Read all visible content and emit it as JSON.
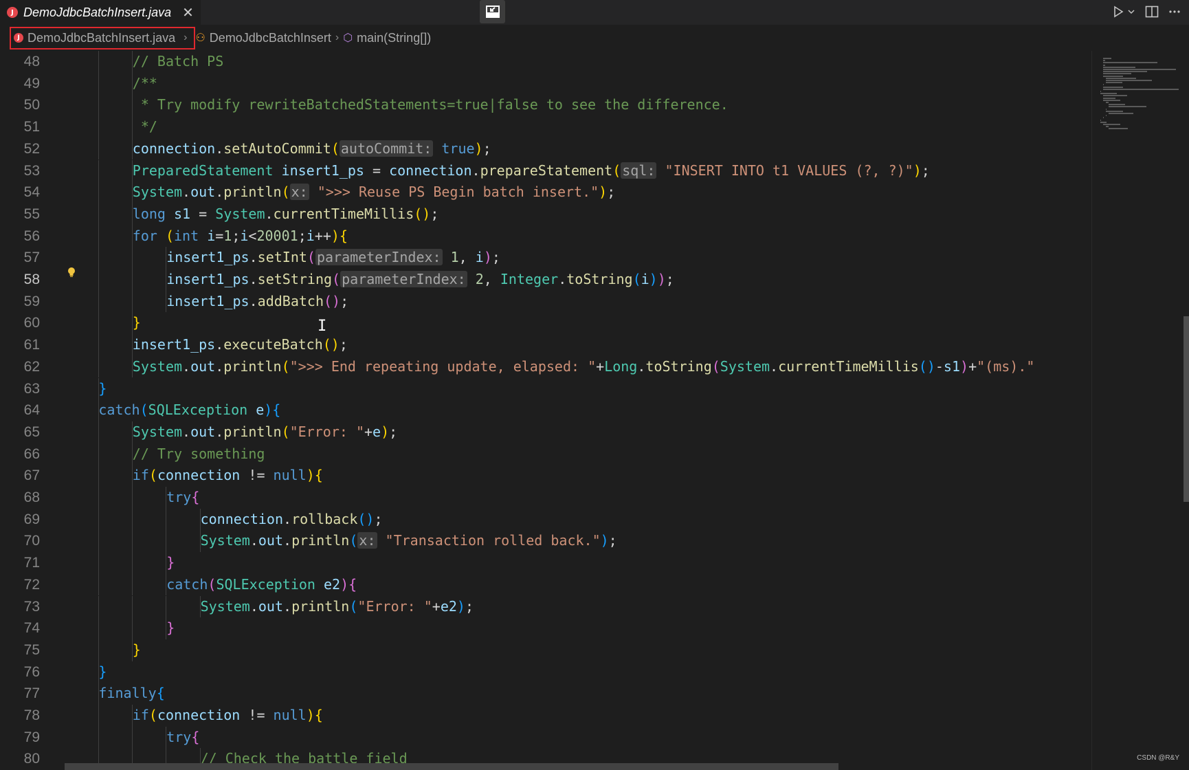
{
  "tab": {
    "title": "DemoJdbcBatchInsert.java",
    "close": "✕"
  },
  "breadcrumb": {
    "file": "DemoJdbcBatchInsert.java",
    "class": "DemoJdbcBatchInsert",
    "method": "main(String[])"
  },
  "editor": {
    "active_line": 58,
    "lines": [
      {
        "n": "48",
        "indent": 2,
        "tokens": [
          [
            "com",
            "// Batch PS"
          ]
        ]
      },
      {
        "n": "49",
        "indent": 2,
        "tokens": [
          [
            "com",
            "/**"
          ]
        ]
      },
      {
        "n": "50",
        "indent": 2,
        "tokens": [
          [
            "com",
            " * Try modify rewriteBatchedStatements=true|false to see the difference."
          ]
        ]
      },
      {
        "n": "51",
        "indent": 2,
        "tokens": [
          [
            "com",
            " */"
          ]
        ]
      },
      {
        "n": "52",
        "indent": 2,
        "tokens": [
          [
            "var",
            "connection"
          ],
          [
            "",
            "."
          ],
          [
            "fn",
            "setAutoCommit"
          ],
          [
            "b1",
            "("
          ],
          [
            "hint",
            "autoCommit:"
          ],
          [
            "",
            " "
          ],
          [
            "kw",
            "true"
          ],
          [
            "b1",
            ")"
          ],
          [
            "",
            ";"
          ]
        ]
      },
      {
        "n": "53",
        "indent": 2,
        "tokens": [
          [
            "type",
            "PreparedStatement"
          ],
          [
            "",
            " "
          ],
          [
            "var",
            "insert1_ps"
          ],
          [
            "",
            " = "
          ],
          [
            "var",
            "connection"
          ],
          [
            "",
            "."
          ],
          [
            "fn",
            "prepareStatement"
          ],
          [
            "b1",
            "("
          ],
          [
            "hint",
            "sql:"
          ],
          [
            "",
            " "
          ],
          [
            "str",
            "\"INSERT INTO t1 VALUES (?, ?)\""
          ],
          [
            "b1",
            ")"
          ],
          [
            "",
            ";"
          ]
        ]
      },
      {
        "n": "54",
        "indent": 2,
        "tokens": [
          [
            "type",
            "System"
          ],
          [
            "",
            "."
          ],
          [
            "var",
            "out"
          ],
          [
            "",
            "."
          ],
          [
            "fn",
            "println"
          ],
          [
            "b1",
            "("
          ],
          [
            "hint",
            "x:"
          ],
          [
            "",
            " "
          ],
          [
            "str",
            "\">>> Reuse PS Begin batch insert.\""
          ],
          [
            "b1",
            ")"
          ],
          [
            "",
            ";"
          ]
        ]
      },
      {
        "n": "55",
        "indent": 2,
        "tokens": [
          [
            "kw",
            "long"
          ],
          [
            "",
            " "
          ],
          [
            "var",
            "s1"
          ],
          [
            "",
            " = "
          ],
          [
            "type",
            "System"
          ],
          [
            "",
            "."
          ],
          [
            "fn",
            "currentTimeMillis"
          ],
          [
            "b1",
            "()"
          ],
          [
            "",
            ";"
          ]
        ]
      },
      {
        "n": "56",
        "indent": 2,
        "tokens": [
          [
            "kw",
            "for"
          ],
          [
            "",
            " "
          ],
          [
            "b1",
            "("
          ],
          [
            "kw",
            "int"
          ],
          [
            "",
            " "
          ],
          [
            "var",
            "i"
          ],
          [
            "",
            "="
          ],
          [
            "num",
            "1"
          ],
          [
            "",
            ";"
          ],
          [
            "var",
            "i"
          ],
          [
            "",
            "<"
          ],
          [
            "num",
            "20001"
          ],
          [
            "",
            ";"
          ],
          [
            "var",
            "i"
          ],
          [
            "",
            "++"
          ],
          [
            "b1",
            ")"
          ],
          [
            "b1",
            "{"
          ]
        ]
      },
      {
        "n": "57",
        "indent": 3,
        "tokens": [
          [
            "var",
            "insert1_ps"
          ],
          [
            "",
            "."
          ],
          [
            "fn",
            "setInt"
          ],
          [
            "b2",
            "("
          ],
          [
            "hint",
            "parameterIndex:"
          ],
          [
            "",
            " "
          ],
          [
            "num",
            "1"
          ],
          [
            "",
            ", "
          ],
          [
            "var",
            "i"
          ],
          [
            "b2",
            ")"
          ],
          [
            "",
            ";"
          ]
        ]
      },
      {
        "n": "58",
        "indent": 3,
        "tokens": [
          [
            "var",
            "insert1_ps"
          ],
          [
            "",
            "."
          ],
          [
            "fn",
            "setString"
          ],
          [
            "b2",
            "("
          ],
          [
            "hint",
            "parameterIndex:"
          ],
          [
            "",
            " "
          ],
          [
            "num",
            "2"
          ],
          [
            "",
            ", "
          ],
          [
            "type",
            "Integer"
          ],
          [
            "",
            "."
          ],
          [
            "fn",
            "toString"
          ],
          [
            "b3",
            "("
          ],
          [
            "var",
            "i"
          ],
          [
            "b3",
            ")"
          ],
          [
            "b2",
            ")"
          ],
          [
            "",
            ";"
          ]
        ]
      },
      {
        "n": "59",
        "indent": 3,
        "tokens": [
          [
            "var",
            "insert1_ps"
          ],
          [
            "",
            "."
          ],
          [
            "fn",
            "addBatch"
          ],
          [
            "b2",
            "()"
          ],
          [
            "",
            ";"
          ]
        ]
      },
      {
        "n": "60",
        "indent": 2,
        "tokens": [
          [
            "b1",
            "}"
          ]
        ]
      },
      {
        "n": "61",
        "indent": 2,
        "tokens": [
          [
            "var",
            "insert1_ps"
          ],
          [
            "",
            "."
          ],
          [
            "fn",
            "executeBatch"
          ],
          [
            "b1",
            "()"
          ],
          [
            "",
            ";"
          ]
        ]
      },
      {
        "n": "62",
        "indent": 2,
        "tokens": [
          [
            "type",
            "System"
          ],
          [
            "",
            "."
          ],
          [
            "var",
            "out"
          ],
          [
            "",
            "."
          ],
          [
            "fn",
            "println"
          ],
          [
            "b1",
            "("
          ],
          [
            "str",
            "\">>> End repeating update, elapsed: \""
          ],
          [
            "",
            "+"
          ],
          [
            "type",
            "Long"
          ],
          [
            "",
            "."
          ],
          [
            "fn",
            "toString"
          ],
          [
            "b2",
            "("
          ],
          [
            "type",
            "System"
          ],
          [
            "",
            "."
          ],
          [
            "fn",
            "currentTimeMillis"
          ],
          [
            "b3",
            "()"
          ],
          [
            "",
            "-"
          ],
          [
            "var",
            "s1"
          ],
          [
            "b2",
            ")"
          ],
          [
            "",
            "+"
          ],
          [
            "str",
            "\"(ms).\""
          ]
        ]
      },
      {
        "n": "63",
        "indent": 1,
        "tokens": [
          [
            "b3",
            "}"
          ]
        ]
      },
      {
        "n": "64",
        "indent": 1,
        "tokens": [
          [
            "kw",
            "catch"
          ],
          [
            "b3",
            "("
          ],
          [
            "type",
            "SQLException"
          ],
          [
            "",
            " "
          ],
          [
            "var",
            "e"
          ],
          [
            "b3",
            ")"
          ],
          [
            "b3",
            "{"
          ]
        ]
      },
      {
        "n": "65",
        "indent": 2,
        "tokens": [
          [
            "type",
            "System"
          ],
          [
            "",
            "."
          ],
          [
            "var",
            "out"
          ],
          [
            "",
            "."
          ],
          [
            "fn",
            "println"
          ],
          [
            "b1",
            "("
          ],
          [
            "str",
            "\"Error: \""
          ],
          [
            "",
            "+"
          ],
          [
            "var",
            "e"
          ],
          [
            "b1",
            ")"
          ],
          [
            "",
            ";"
          ]
        ]
      },
      {
        "n": "66",
        "indent": 2,
        "tokens": [
          [
            "com",
            "// Try something"
          ]
        ]
      },
      {
        "n": "67",
        "indent": 2,
        "tokens": [
          [
            "kw",
            "if"
          ],
          [
            "b1",
            "("
          ],
          [
            "var",
            "connection"
          ],
          [
            "",
            " != "
          ],
          [
            "kw",
            "null"
          ],
          [
            "b1",
            ")"
          ],
          [
            "b1",
            "{"
          ]
        ]
      },
      {
        "n": "68",
        "indent": 3,
        "tokens": [
          [
            "kw",
            "try"
          ],
          [
            "b2",
            "{"
          ]
        ]
      },
      {
        "n": "69",
        "indent": 4,
        "tokens": [
          [
            "var",
            "connection"
          ],
          [
            "",
            "."
          ],
          [
            "fn",
            "rollback"
          ],
          [
            "b3",
            "()"
          ],
          [
            "",
            ";"
          ]
        ]
      },
      {
        "n": "70",
        "indent": 4,
        "tokens": [
          [
            "type",
            "System"
          ],
          [
            "",
            "."
          ],
          [
            "var",
            "out"
          ],
          [
            "",
            "."
          ],
          [
            "fn",
            "println"
          ],
          [
            "b3",
            "("
          ],
          [
            "hint",
            "x:"
          ],
          [
            "",
            " "
          ],
          [
            "str",
            "\"Transaction rolled back.\""
          ],
          [
            "b3",
            ")"
          ],
          [
            "",
            ";"
          ]
        ]
      },
      {
        "n": "71",
        "indent": 3,
        "tokens": [
          [
            "b2",
            "}"
          ]
        ]
      },
      {
        "n": "72",
        "indent": 3,
        "tokens": [
          [
            "kw",
            "catch"
          ],
          [
            "b2",
            "("
          ],
          [
            "type",
            "SQLException"
          ],
          [
            "",
            " "
          ],
          [
            "var",
            "e2"
          ],
          [
            "b2",
            ")"
          ],
          [
            "b2",
            "{"
          ]
        ]
      },
      {
        "n": "73",
        "indent": 4,
        "tokens": [
          [
            "type",
            "System"
          ],
          [
            "",
            "."
          ],
          [
            "var",
            "out"
          ],
          [
            "",
            "."
          ],
          [
            "fn",
            "println"
          ],
          [
            "b3",
            "("
          ],
          [
            "str",
            "\"Error: \""
          ],
          [
            "",
            "+"
          ],
          [
            "var",
            "e2"
          ],
          [
            "b3",
            ")"
          ],
          [
            "",
            ";"
          ]
        ]
      },
      {
        "n": "74",
        "indent": 3,
        "tokens": [
          [
            "b2",
            "}"
          ]
        ]
      },
      {
        "n": "75",
        "indent": 2,
        "tokens": [
          [
            "b1",
            "}"
          ]
        ]
      },
      {
        "n": "76",
        "indent": 1,
        "tokens": [
          [
            "b3",
            "}"
          ]
        ]
      },
      {
        "n": "77",
        "indent": 1,
        "tokens": [
          [
            "kw",
            "finally"
          ],
          [
            "b3",
            "{"
          ]
        ]
      },
      {
        "n": "78",
        "indent": 2,
        "tokens": [
          [
            "kw",
            "if"
          ],
          [
            "b1",
            "("
          ],
          [
            "var",
            "connection"
          ],
          [
            "",
            " != "
          ],
          [
            "kw",
            "null"
          ],
          [
            "b1",
            ")"
          ],
          [
            "b1",
            "{"
          ]
        ]
      },
      {
        "n": "79",
        "indent": 3,
        "tokens": [
          [
            "kw",
            "try"
          ],
          [
            "b2",
            "{"
          ]
        ]
      },
      {
        "n": "80",
        "indent": 4,
        "tokens": [
          [
            "com",
            "// Check the battle field"
          ]
        ]
      }
    ]
  },
  "watermark": "CSDN @R&Y",
  "colors": {
    "background": "#1e1e1e",
    "breadcrumb_highlight": "#e0282e"
  },
  "icons": {
    "tab_file": "java-file-icon",
    "center": "toggle-panel-icon",
    "run": "run-icon",
    "run_dropdown": "chevron-down-icon",
    "split": "split-editor-icon",
    "more": "more-actions-icon",
    "lightbulb": "lightbulb-icon"
  }
}
